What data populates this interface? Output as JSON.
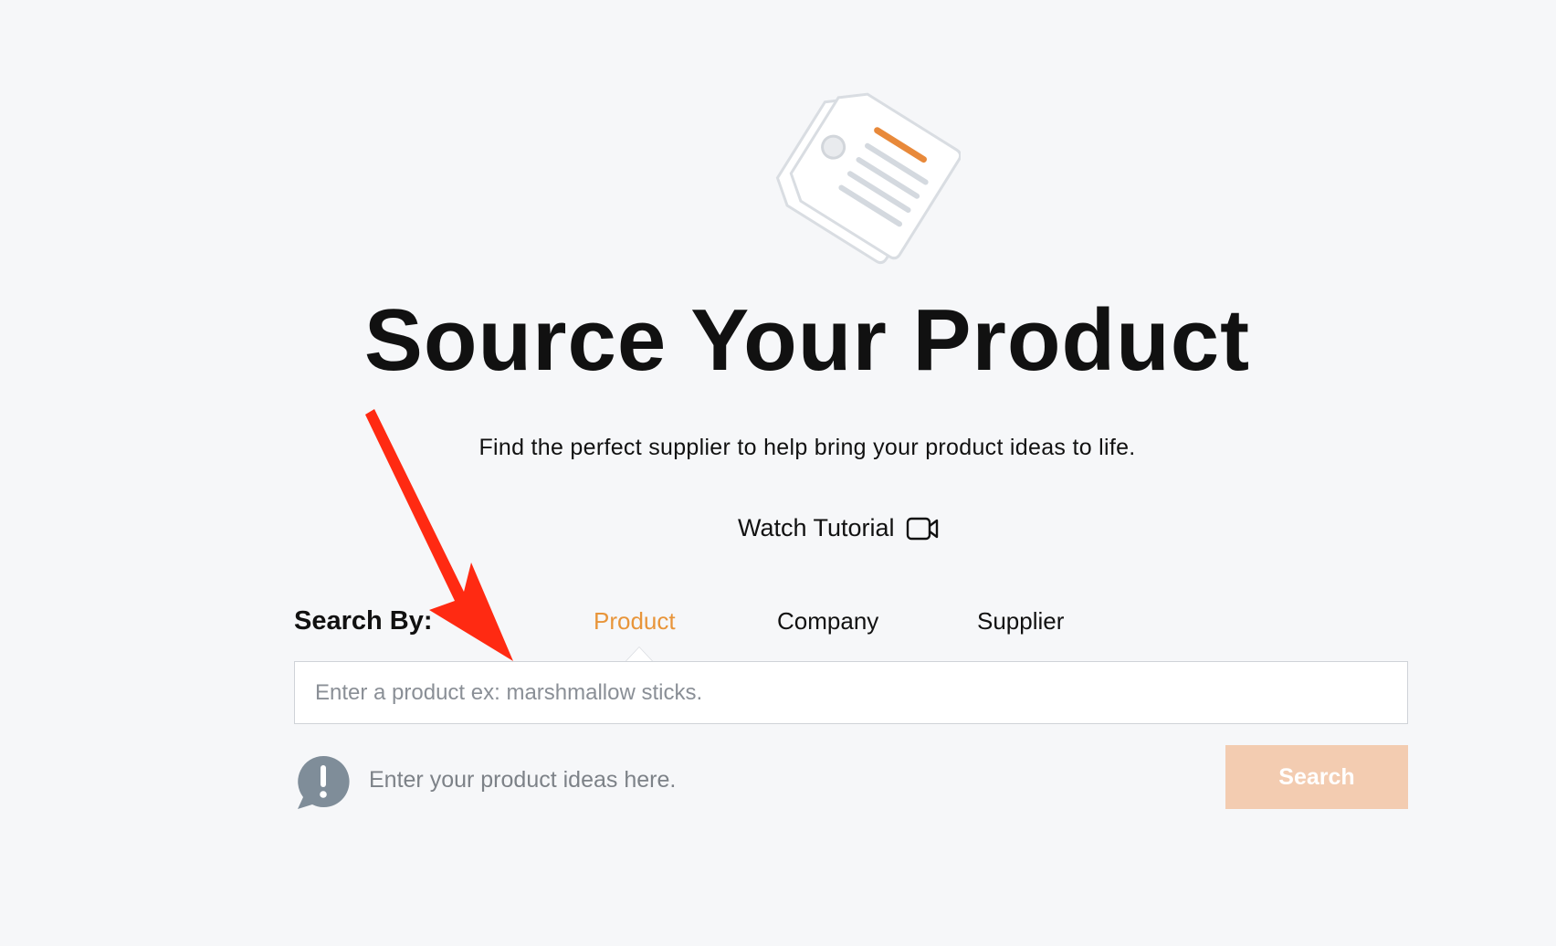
{
  "header": {
    "title": "Source Your Product",
    "subtitle": "Find the perfect supplier to help bring your product ideas to life.",
    "tutorial_label": "Watch Tutorial",
    "tutorial_icon": "video-camera-icon",
    "hero_icon": "price-tag-icon"
  },
  "search": {
    "by_label": "Search By:",
    "tabs": [
      {
        "label": "Product",
        "active": true
      },
      {
        "label": "Company",
        "active": false
      },
      {
        "label": "Supplier",
        "active": false
      }
    ],
    "placeholder": "Enter a product ex: marshmallow sticks.",
    "value": "",
    "hint_icon": "exclamation-speech-bubble-icon",
    "hint": "Enter your product ideas here.",
    "button_label": "Search"
  },
  "colors": {
    "accent": "#e8953a",
    "button_disabled": "#f3ccb1",
    "background": "#f6f7f9",
    "annotation_arrow": "#ff2a12",
    "hint_icon": "#7f8d99"
  }
}
